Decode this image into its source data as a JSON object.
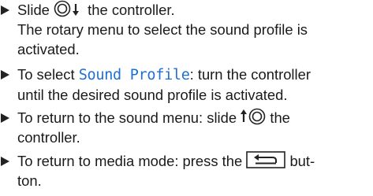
{
  "steps": [
    {
      "lines": [
        {
          "pre": "Slide",
          "icon": "controller-down-icon",
          "post": "the controller."
        },
        {
          "text": "The rotary menu to select the sound profile is"
        },
        {
          "text": "activated."
        }
      ]
    },
    {
      "lines": [
        {
          "pre": "To select",
          "mono": "Sound Profile",
          "post": ": turn the controller"
        },
        {
          "text": "until the desired sound profile is activated."
        }
      ]
    },
    {
      "lines": [
        {
          "pre": "To return to the sound menu: slide",
          "icon": "controller-up-icon",
          "post": "the"
        },
        {
          "text": "controller."
        }
      ]
    },
    {
      "lines": [
        {
          "pre": "To return to media mode: press the",
          "icon": "back-button-icon",
          "post": "but-"
        },
        {
          "text": "ton."
        }
      ]
    }
  ]
}
